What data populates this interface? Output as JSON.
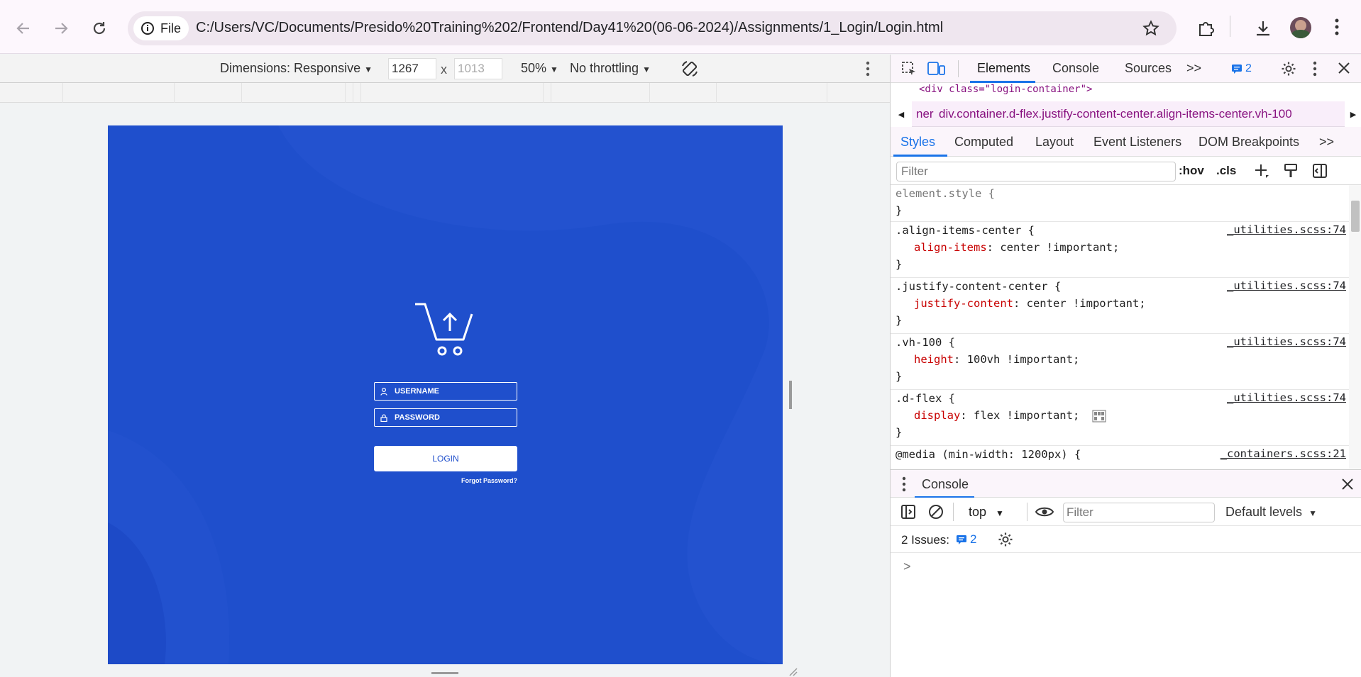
{
  "browser": {
    "url_chip": "File",
    "url": "C:/Users/VC/Documents/Presido%20Training%202/Frontend/Day41%20(06-06-2024)/Assignments/1_Login/Login.html"
  },
  "device_toolbar": {
    "dimensions_label": "Dimensions: Responsive",
    "width_value": "1267",
    "height_value": "1013",
    "times": "x",
    "zoom": "50%",
    "throttling": "No throttling"
  },
  "page": {
    "background_color": "#1f4fcc",
    "username_placeholder": "USERNAME",
    "password_placeholder": "PASSWORD",
    "login_label": "LOGIN",
    "forgot_label": "Forgot Password?"
  },
  "devtools": {
    "tabs": [
      "Elements",
      "Console",
      "Sources"
    ],
    "more": ">>",
    "issues_count": "2",
    "dom_line": "<div class=\"login-container\">",
    "crumb_prev": "ner",
    "crumb_current": "div.container.d-flex.justify-content-center.align-items-center.vh-100",
    "subtabs": [
      "Styles",
      "Computed",
      "Layout",
      "Event Listeners",
      "DOM Breakpoints"
    ],
    "filter_placeholder": "Filter",
    "hov": ":hov",
    "cls": ".cls",
    "rules": [
      {
        "selector": "element.style {",
        "prop": "",
        "value": "",
        "close": "}",
        "src": ""
      },
      {
        "selector": ".align-items-center {",
        "prop": "align-items",
        "value": ": center !important;",
        "close": "}",
        "src": "_utilities.scss:74"
      },
      {
        "selector": ".justify-content-center {",
        "prop": "justify-content",
        "value": ": center !important;",
        "close": "}",
        "src": "_utilities.scss:74"
      },
      {
        "selector": ".vh-100 {",
        "prop": "height",
        "value": ": 100vh !important;",
        "close": "}",
        "src": "_utilities.scss:74"
      },
      {
        "selector": ".d-flex {",
        "prop": "display",
        "value": ": flex !important;",
        "close": "}",
        "src": "_utilities.scss:74"
      },
      {
        "selector": "@media (min-width: 1200px) {",
        "prop": "",
        "value": "",
        "close": "",
        "src": "_containers.scss:21"
      }
    ],
    "console": {
      "title": "Console",
      "context": "top",
      "filter_placeholder": "Filter",
      "levels": "Default levels",
      "issues_label": "2 Issues:",
      "issues_count": "2",
      "prompt": ">"
    }
  }
}
